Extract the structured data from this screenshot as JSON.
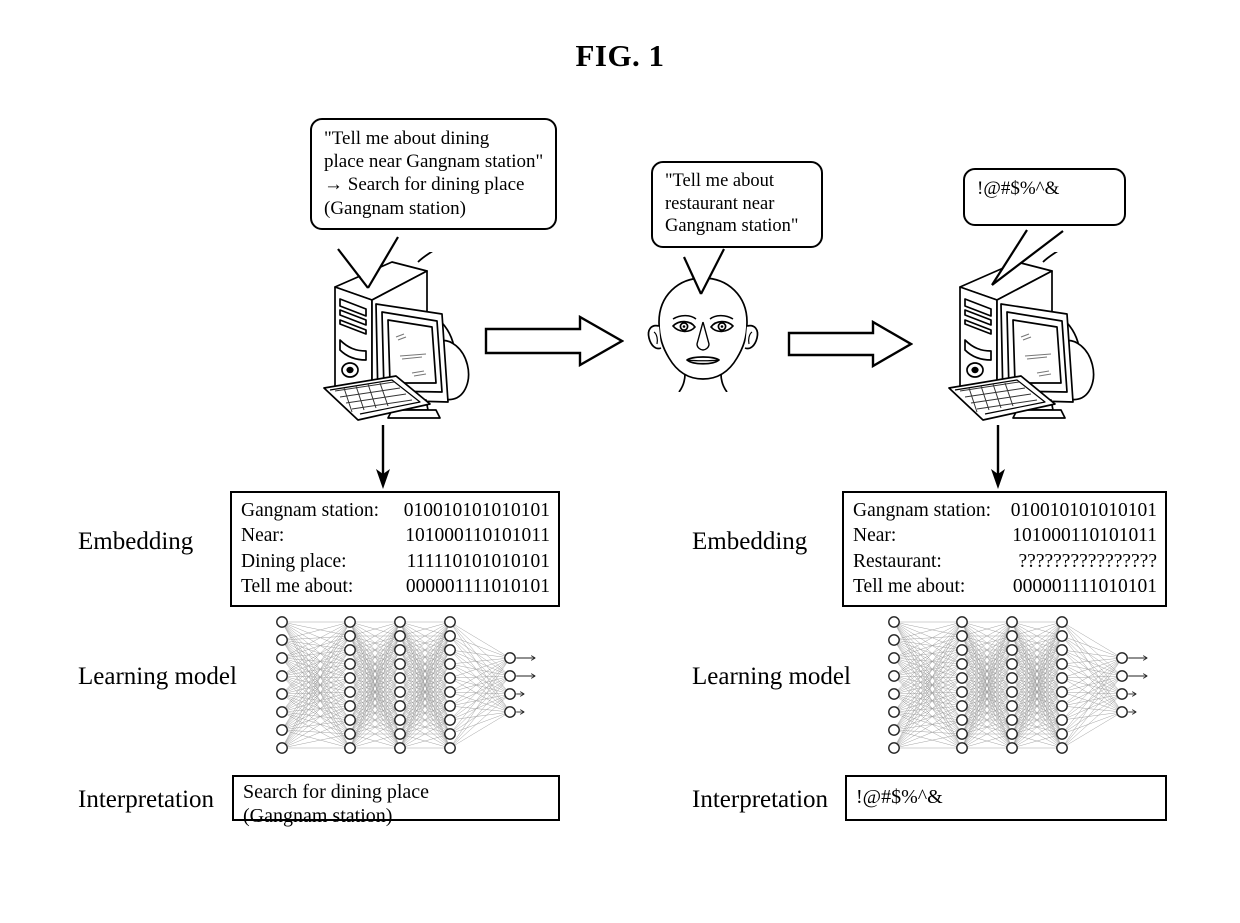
{
  "figure": {
    "title": "FIG. 1"
  },
  "bubbles": {
    "left": {
      "name": "computer-output-bubble",
      "lines": [
        "\"Tell me about dining",
        "place near Gangnam station\"",
        "→ Search for dining place",
        "(Gangnam station)"
      ]
    },
    "middle": {
      "name": "user-utterance-bubble",
      "lines": [
        "\"Tell me about",
        "restaurant near",
        "Gangnam station\""
      ]
    },
    "right": {
      "name": "computer-garbled-bubble",
      "lines": [
        "!@#$%^&"
      ]
    }
  },
  "rows": {
    "embedding_label": "Embedding",
    "learning_model_label": "Learning model",
    "interpretation_label": "Interpretation"
  },
  "left_panel": {
    "embedding": [
      {
        "key": "Gangnam station:",
        "value": "010010101010101"
      },
      {
        "key": "Near:",
        "value": "101000110101011"
      },
      {
        "key": "Dining place:",
        "value": "111110101010101"
      },
      {
        "key": "Tell me about:",
        "value": "000001111010101"
      }
    ],
    "interpretation": [
      "Search for dining place",
      "(Gangnam station)"
    ]
  },
  "right_panel": {
    "embedding": [
      {
        "key": "Gangnam station:",
        "value": "010010101010101"
      },
      {
        "key": "Near:",
        "value": "101000110101011"
      },
      {
        "key": "Restaurant:",
        "value": "????????????????"
      },
      {
        "key": "Tell me about:",
        "value": "000001111010101"
      }
    ],
    "interpretation": [
      "!@#$%^&"
    ]
  },
  "icons": {
    "computer_left": "desktop-computer-icon",
    "computer_right": "desktop-computer-icon",
    "person": "human-head-icon",
    "flow_arrow_1": "block-arrow-right-icon",
    "flow_arrow_2": "block-arrow-right-icon",
    "down_arrow_left": "arrow-down-icon",
    "down_arrow_right": "arrow-down-icon",
    "neural_net_left": "neural-network-icon",
    "neural_net_right": "neural-network-icon"
  },
  "neural_network": {
    "layers": [
      8,
      10,
      10,
      10,
      4
    ],
    "node_color": "#ffffff",
    "stroke_color": "#222222",
    "edge_color": "#9a9a9a"
  },
  "colors": {
    "ink": "#000000",
    "paper": "#ffffff",
    "edge": "#9a9a9a"
  }
}
